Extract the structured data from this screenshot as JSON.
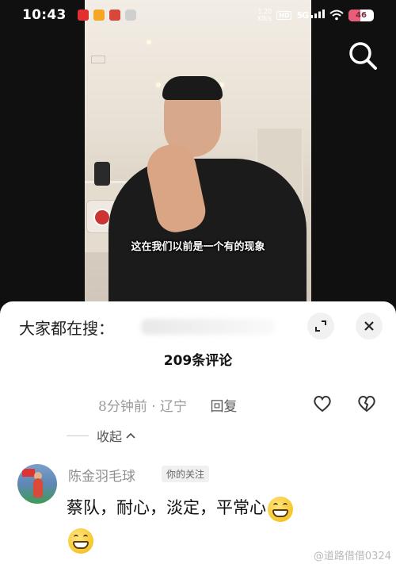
{
  "status_bar": {
    "time": "10:43",
    "net_speed_value": "1.20",
    "net_speed_unit": "KB/s",
    "hd_label": "HD",
    "signal_label": "5G",
    "battery_level": "46",
    "battery_color": "#e85d79"
  },
  "video": {
    "subtitle": "这在我们以前是一个有的现象"
  },
  "comments_sheet": {
    "search_hint": "大家都在搜：",
    "title": "209条评论",
    "previous_reply": {
      "time_location": "8分钟前 · 辽宁",
      "reply_label": "回复"
    },
    "collapse_label": "收起",
    "comment": {
      "username": "陈金羽毛球",
      "follow_tag": "你的关注",
      "text": "蔡队，耐心，淡定，平常心"
    },
    "watermark": "@道路借借0324"
  },
  "icons": {
    "search": "search-icon",
    "expand": "expand-icon",
    "close": "close-icon",
    "like": "heart-icon",
    "dislike": "broken-heart-icon",
    "collapse": "chevron-up-icon",
    "emoji": "grinning-emoji-icon"
  }
}
